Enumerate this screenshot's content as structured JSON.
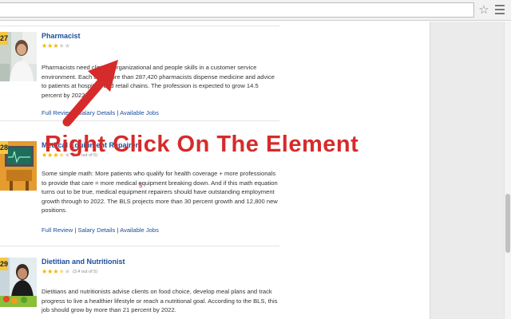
{
  "overlay": {
    "instruction": "Right Click On The Element",
    "cursor_letter": "s"
  },
  "jobs": [
    {
      "rank": "27",
      "title": "Pharmacist",
      "stars": 3,
      "rating_text": "",
      "description": "Pharmacists need clinical, organizational and people skills in a customer service environment. Each day, more than 287,420 pharmacists dispense medicine and advice to patients at hospitals and retail chains. The profession is expected to grow 14.5 percent by 2022.",
      "links": [
        "Full Review",
        "Salary Details",
        "Available Jobs"
      ]
    },
    {
      "rank": "28",
      "title": "Medical Equipment Repairer",
      "stars": 3.4,
      "rating_text": "(3.4 out of 5)",
      "description": "Some simple math: More patients who qualify for health coverage + more professionals to provide that care = more medical equipment breaking down. And if this math equation turns out to be true, medical equipment repairers should have outstanding employment growth through to 2022. The BLS projects more than 30 percent growth and 12,800 new positions.",
      "links": [
        "Full Review",
        "Salary Details",
        "Available Jobs"
      ]
    },
    {
      "rank": "29",
      "title": "Dietitian and Nutritionist",
      "stars": 3.4,
      "rating_text": "(3.4 out of 5)",
      "description": "Dietitians and nutritionists advise clients on food choice, develop meal plans and track progress to live a healthier lifestyle or reach a nutritional goal. According to the BLS, this job should grow by more than 21 percent by 2022.",
      "links": []
    }
  ],
  "icons": {
    "bookmark": "star-icon",
    "menu": "hamburger-menu-icon"
  },
  "colors": {
    "link": "#1a4d9c",
    "rank_badge": "#f5c842",
    "overlay": "#d62b2b",
    "star": "#f0b400"
  }
}
